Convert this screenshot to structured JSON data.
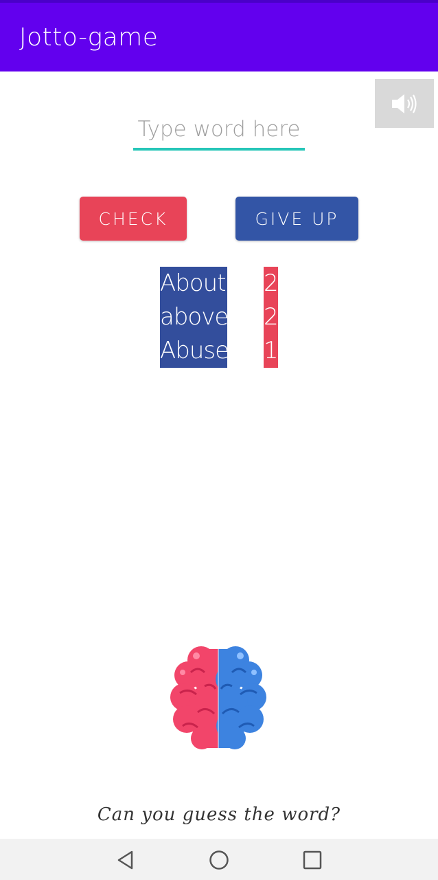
{
  "app": {
    "title": "Jotto-game"
  },
  "toolbar": {
    "sound_icon": "speaker-volume-icon"
  },
  "input": {
    "placeholder": "Type word here",
    "value": ""
  },
  "buttons": {
    "check_label": "CHECK",
    "give_up_label": "GIVE UP"
  },
  "guesses": [
    {
      "word": "About",
      "score": "2"
    },
    {
      "word": "above",
      "score": "2"
    },
    {
      "word": "Abuse",
      "score": "1"
    }
  ],
  "tagline": "Can you guess the word?",
  "navigation": {
    "back_icon": "back-triangle-icon",
    "home_icon": "home-circle-icon",
    "recents_icon": "recents-square-icon"
  },
  "colors": {
    "app_bar": "#6200ee",
    "accent_red": "#e84458",
    "accent_blue": "#3355a6",
    "input_underline": "#26c6b8"
  }
}
